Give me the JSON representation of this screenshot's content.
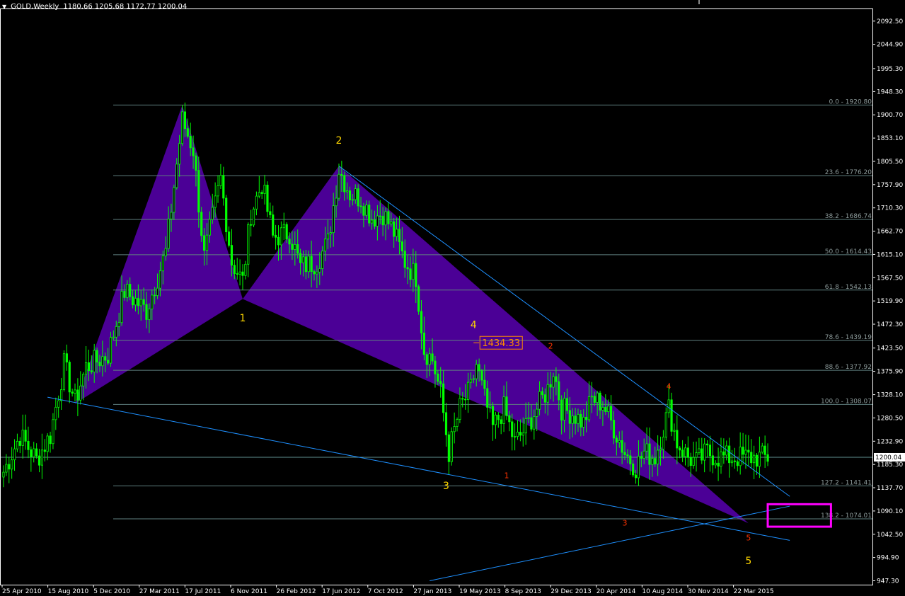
{
  "header": {
    "symbol": "GOLD,Weekly",
    "ohlc": "1180.66 1205.68 1172.77 1200.04"
  },
  "colors": {
    "background": "#000000",
    "candle": "#00ff00",
    "pattern_fill": "#4b0096",
    "trendline": "#1e90ff",
    "fib_line": "#5f7f7f",
    "axis_text": "#ffffff",
    "label_yellow": "#ffd700",
    "label_red": "#ff3300",
    "target_box": "#ff00ff",
    "callout": "#ff8c00"
  },
  "chart_data": {
    "type": "candlestick",
    "symbol": "GOLD",
    "timeframe": "Weekly",
    "ylim": [
      947.3,
      2120
    ],
    "y_ticks": [
      "2092.50",
      "2044.90",
      "1995.30",
      "1948.30",
      "1900.70",
      "1853.10",
      "1805.50",
      "1757.90",
      "1710.30",
      "1662.70",
      "1615.10",
      "1567.50",
      "1519.90",
      "1472.30",
      "1423.50",
      "1375.90",
      "1328.10",
      "1280.50",
      "1232.90",
      "1185.30",
      "1137.70",
      "1090.10",
      "1042.50",
      "994.90",
      "947.30"
    ],
    "current_price": "1200.04",
    "x_ticks": [
      "25 Apr 2010",
      "15 Aug 2010",
      "5 Dec 2010",
      "27 Mar 2011",
      "17 Jul 2011",
      "6 Nov 2011",
      "26 Feb 2012",
      "17 Jun 2012",
      "7 Oct 2012",
      "27 Jan 2013",
      "19 May 2013",
      "8 Sep 2013",
      "29 Dec 2013",
      "20 Apr 2014",
      "10 Aug 2014",
      "30 Nov 2014",
      "22 Mar 2015"
    ],
    "fib_levels": [
      {
        "label": "0.0 - 1920.80",
        "price": 1920.8
      },
      {
        "label": "23.6 - 1776.20",
        "price": 1776.2
      },
      {
        "label": "38.2 - 1686.74",
        "price": 1686.74
      },
      {
        "label": "50.0 - 1614.43",
        "price": 1614.43
      },
      {
        "label": "61.8 - 1542.13",
        "price": 1542.13
      },
      {
        "label": "78.6 - 1439.19",
        "price": 1439.19
      },
      {
        "label": "88.6 - 1377.92",
        "price": 1377.92
      },
      {
        "label": "100.0 - 1308.07",
        "price": 1308.07
      },
      {
        "label": "127.2 - 1141.41",
        "price": 1141.41
      },
      {
        "label": "138.2 - 1074.01",
        "price": 1074.01
      }
    ],
    "pattern_points": [
      {
        "week": 26,
        "price": 1310
      },
      {
        "week": 65,
        "price": 1920
      },
      {
        "week": 87,
        "price": 1524
      },
      {
        "week": 122,
        "price": 1796
      },
      {
        "week": 271,
        "price": 1065
      }
    ],
    "trendlines": [
      {
        "from": {
          "week": 16,
          "price": 1323
        },
        "to": {
          "week": 286,
          "price": 1030
        }
      },
      {
        "from": {
          "week": 122,
          "price": 1796
        },
        "to": {
          "week": 286,
          "price": 1120
        }
      },
      {
        "from": {
          "week": 155,
          "price": 947.3
        },
        "to": {
          "week": 286,
          "price": 1100
        }
      }
    ],
    "wave_labels": [
      {
        "text": "1",
        "week": 87,
        "price": 1478,
        "color": "yellow",
        "size": 14
      },
      {
        "text": "2",
        "week": 122,
        "price": 1842,
        "color": "yellow",
        "size": 14
      },
      {
        "text": "3",
        "week": 161,
        "price": 1135,
        "color": "yellow",
        "size": 14
      },
      {
        "text": "4",
        "week": 171,
        "price": 1464,
        "color": "yellow",
        "size": 14
      },
      {
        "text": "5",
        "week": 271,
        "price": 981,
        "color": "yellow",
        "size": 14
      },
      {
        "text": "1",
        "week": 183,
        "price": 1157,
        "color": "red",
        "size": 11
      },
      {
        "text": "2",
        "week": 199,
        "price": 1422,
        "color": "red",
        "size": 11
      },
      {
        "text": "3",
        "week": 226,
        "price": 1060,
        "color": "red",
        "size": 11
      },
      {
        "text": "4",
        "week": 242,
        "price": 1340,
        "color": "red",
        "size": 11
      },
      {
        "text": "5",
        "week": 271,
        "price": 1030,
        "color": "red",
        "size": 11
      }
    ],
    "callout": {
      "text": "1434.33",
      "week": 172,
      "price": 1434.33
    },
    "target_zone": {
      "week_from": 278,
      "week_to": 301,
      "price_low": 1058,
      "price_high": 1104
    },
    "grid": false,
    "candles": {
      "weeks": 279,
      "anchors": [
        [
          0,
          1170
        ],
        [
          6,
          1245
        ],
        [
          12,
          1195
        ],
        [
          17,
          1245
        ],
        [
          22,
          1390
        ],
        [
          26,
          1315
        ],
        [
          30,
          1385
        ],
        [
          38,
          1410
        ],
        [
          44,
          1540
        ],
        [
          52,
          1500
        ],
        [
          59,
          1620
        ],
        [
          65,
          1890
        ],
        [
          69,
          1830
        ],
        [
          73,
          1610
        ],
        [
          79,
          1770
        ],
        [
          83,
          1600
        ],
        [
          87,
          1560
        ],
        [
          90,
          1700
        ],
        [
          94,
          1760
        ],
        [
          98,
          1650
        ],
        [
          104,
          1660
        ],
        [
          108,
          1590
        ],
        [
          114,
          1600
        ],
        [
          118,
          1640
        ],
        [
          122,
          1790
        ],
        [
          126,
          1740
        ],
        [
          130,
          1730
        ],
        [
          134,
          1690
        ],
        [
          138,
          1700
        ],
        [
          142,
          1660
        ],
        [
          146,
          1600
        ],
        [
          150,
          1570
        ],
        [
          153,
          1420
        ],
        [
          156,
          1400
        ],
        [
          159,
          1330
        ],
        [
          162,
          1210
        ],
        [
          166,
          1300
        ],
        [
          170,
          1340
        ],
        [
          172,
          1390
        ],
        [
          175,
          1320
        ],
        [
          178,
          1260
        ],
        [
          182,
          1300
        ],
        [
          186,
          1230
        ],
        [
          190,
          1260
        ],
        [
          194,
          1300
        ],
        [
          198,
          1340
        ],
        [
          200,
          1380
        ],
        [
          203,
          1300
        ],
        [
          207,
          1290
        ],
        [
          211,
          1270
        ],
        [
          214,
          1320
        ],
        [
          218,
          1310
        ],
        [
          222,
          1260
        ],
        [
          226,
          1210
        ],
        [
          230,
          1180
        ],
        [
          233,
          1210
        ],
        [
          237,
          1200
        ],
        [
          240,
          1260
        ],
        [
          242,
          1300
        ],
        [
          245,
          1230
        ],
        [
          249,
          1200
        ],
        [
          252,
          1190
        ],
        [
          256,
          1210
        ],
        [
          260,
          1200
        ],
        [
          264,
          1200
        ],
        [
          268,
          1200
        ]
      ]
    }
  }
}
